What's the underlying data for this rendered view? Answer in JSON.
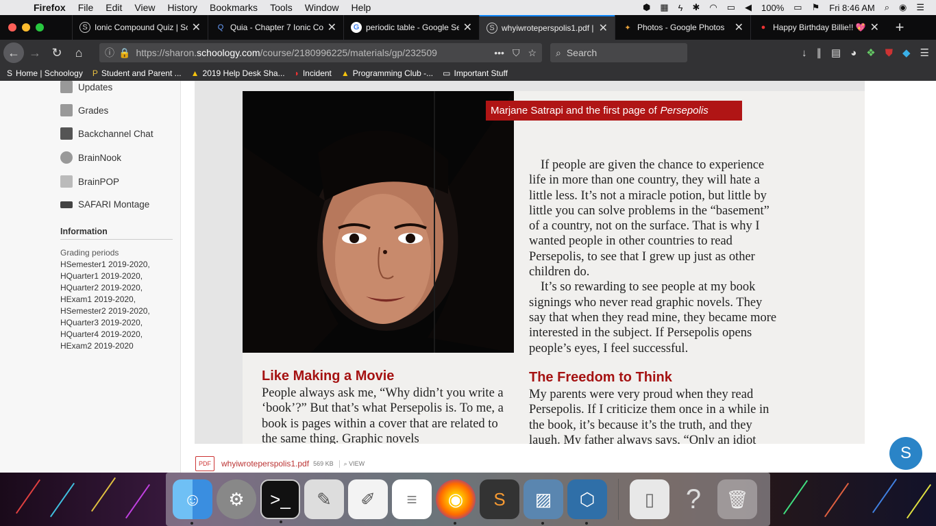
{
  "menubar": {
    "app": "Firefox",
    "items": [
      "File",
      "Edit",
      "View",
      "History",
      "Bookmarks",
      "Tools",
      "Window",
      "Help"
    ],
    "battery": "100%",
    "clock": "Fri 8:46 AM"
  },
  "tabs": [
    {
      "title": "Ionic Compound Quiz | Sc",
      "favicon": "S",
      "favicon_color": "#555"
    },
    {
      "title": "Quia - Chapter 7 Ionic Co",
      "favicon": "Q",
      "favicon_color": "#1b3a6b"
    },
    {
      "title": "periodic table - Google Se",
      "favicon": "G",
      "favicon_color": "#4285f4"
    },
    {
      "title": "whyiwroteperspolis1.pdf |",
      "favicon": "S",
      "favicon_color": "#555",
      "active": true
    },
    {
      "title": "Photos - Google Photos",
      "favicon": "✦",
      "favicon_color": "#e9a23b"
    },
    {
      "title": "Happy Birthday Billie!! 💖",
      "favicon": "●",
      "favicon_color": "#e33"
    }
  ],
  "navbar": {
    "url_prefix": "https://sharon.",
    "url_domain": "schoology.com",
    "url_path": "/course/2180996225/materials/gp/232509",
    "search_placeholder": "Search"
  },
  "bookmarks": [
    {
      "label": "Home | Schoology",
      "icon": "S"
    },
    {
      "label": "Student and Parent ...",
      "icon": "P"
    },
    {
      "label": "2019 Help Desk Sha...",
      "icon": "▲"
    },
    {
      "label": "Incident",
      "icon": "◗"
    },
    {
      "label": "Programming Club -...",
      "icon": "▲"
    },
    {
      "label": "Important Stuff",
      "icon": "▭"
    }
  ],
  "sidebar": {
    "items": [
      "Updates",
      "Grades",
      "Backchannel Chat",
      "BrainNook",
      "BrainPOP",
      "SAFARI Montage"
    ],
    "info_heading": "Information",
    "grading_label": "Grading periods",
    "grading_periods": [
      "HSemester1 2019-2020,",
      "HQuarter1 2019-2020,",
      "HQuarter2 2019-2020,",
      "HExam1 2019-2020,",
      "HSemester2 2019-2020,",
      "HQuarter3 2019-2020,",
      "HQuarter4 2019-2020,",
      "HExam2 2019-2020"
    ]
  },
  "document": {
    "caption": "Marjane Satrapi and the first page of",
    "caption_italic": "Persepolis",
    "para1": "If people are given the chance to experience life in more than one country, they will hate a little less. It’s not a miracle potion, but little by little you can solve problems in the “base­ment” of a country, not on the surface. That is why I wanted people in other countries to read Persepolis, to see that I grew up just as other children do.",
    "para2": "It’s so rewarding to see people at my book signings who never read graphic novels. They say that when they read mine, they became more interested in the subject. If Persepolis opens people’s eyes, I feel successful.",
    "heading1": "Like Making a Movie",
    "para3": "People always ask me, “Why didn’t you write a ‘book’?” But that’s what Persepolis is. To me, a book is pages within a cover that are related to the same thing. Graphic novels",
    "heading2": "The Freedom to Think",
    "para4": "My parents were very proud when they read Persepolis. If I criticize them once in a while in the book, it’s because it’s the truth, and they laugh. My father always says, “Only an idiot"
  },
  "attachment": {
    "icon_label": "PDF",
    "filename": "whyiwroteperspolis1.pdf",
    "size": "569 KB",
    "view": "VIEW"
  },
  "avatar_letter": "S",
  "colors": {
    "accent_blue": "#0a84ff",
    "caption_red": "#b01515",
    "heading_red": "#a51212",
    "avatar_blue": "#2a84c7"
  }
}
